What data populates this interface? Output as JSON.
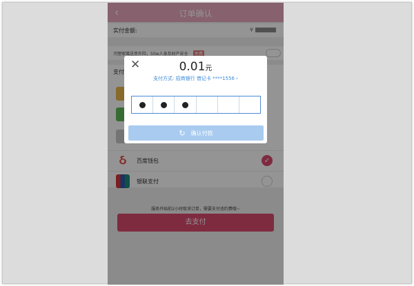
{
  "header": {
    "back_icon": "‹",
    "title": "订单确认"
  },
  "order": {
    "amount_label": "实付金额:",
    "amount_value": "¥"
  },
  "insurance": {
    "text": "河狸家赠送意外险，50w人身及财产安全",
    "tag": "免费"
  },
  "payment_section": {
    "title": "支付"
  },
  "payment_methods": [
    {
      "name": "百度钱包",
      "selected": true
    },
    {
      "name": "银联支付",
      "selected": false
    }
  ],
  "notice": {
    "text": "服务开始前2小时取消订单，需要支付违约费哦~"
  },
  "pay_button": {
    "label": "去支付"
  },
  "dialog": {
    "close_icon": "✕",
    "amount": "0.01",
    "amount_unit": "元",
    "method_text": "支付方式: 招商银行 借记卡 ****1556 ›",
    "pin_entered": 3,
    "pin_length": 6,
    "confirm_icon": "↻",
    "confirm_label": "确认付款"
  },
  "colors": {
    "accent": "#d94a6f",
    "link": "#3b8ad9",
    "confirm_disabled": "#a8cbef"
  }
}
